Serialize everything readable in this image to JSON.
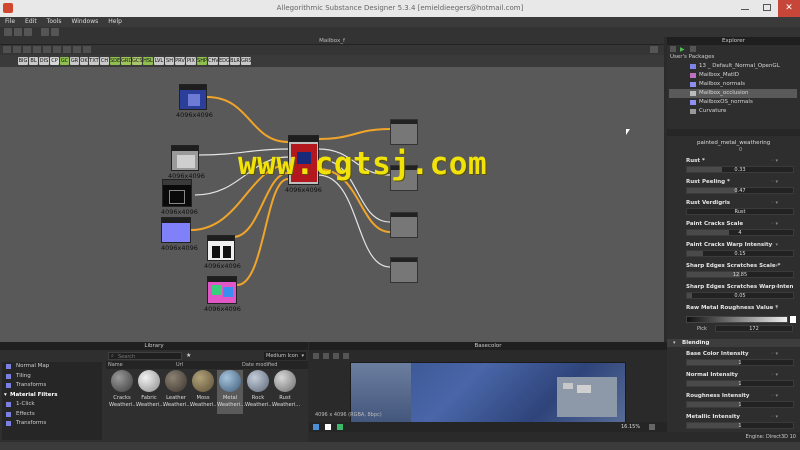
{
  "window": {
    "title": "Allegorithmic Substance Designer 5.3.4 [emieldieegers@hotmail.com]"
  },
  "menu": [
    "File",
    "Edit",
    "Tools",
    "Windows",
    "Help"
  ],
  "graph": {
    "tab_title": "Mailbox_f",
    "chips": [
      "BIG",
      "BL",
      "DIS",
      "CP",
      "GC",
      "GR",
      "OK",
      "TXT",
      "CH",
      "SDE",
      "GRD",
      "GCS",
      "HSL",
      "LVL",
      "SH",
      "PRV",
      "PIX",
      "SHP",
      "CHV",
      "EDG",
      "BLR",
      "GRS"
    ],
    "node_res": "4096x4096",
    "watermark": "www.cgtsj.com"
  },
  "library": {
    "title": "Library",
    "search_placeholder": "Search",
    "size_option": "Medium Icon",
    "columns": [
      "Name",
      "Url",
      "Date modified"
    ],
    "tree": [
      {
        "label": "Normal Map",
        "type": "item"
      },
      {
        "label": "Tiling",
        "type": "item"
      },
      {
        "label": "Transforms",
        "type": "item"
      },
      {
        "label": "Material Filters",
        "type": "category"
      },
      {
        "label": "1-Click",
        "type": "item"
      },
      {
        "label": "Effects",
        "type": "item"
      },
      {
        "label": "Transforms",
        "type": "item"
      }
    ],
    "materials": [
      {
        "line1": "Cracks",
        "line2": "Weatheri..."
      },
      {
        "line1": "Fabric",
        "line2": "Weatheri..."
      },
      {
        "line1": "Leather",
        "line2": "Weatheri..."
      },
      {
        "line1": "Moss",
        "line2": "Weatheri..."
      },
      {
        "line1": "Metal",
        "line2": "Weatheri..."
      },
      {
        "line1": "Rock",
        "line2": "Weatheri..."
      },
      {
        "line1": "Rust",
        "line2": "Weatheri..."
      }
    ]
  },
  "baseview": {
    "title": "Basecolor",
    "info": "4096 x 4096 (RGBA, 8bpc)",
    "zoom": "16.15%"
  },
  "explorer": {
    "title": "Explorer",
    "section": "User's Packages",
    "packages": [
      {
        "label": "13 _ Default_Normal_OpenGL",
        "color": "#7e84e6"
      },
      {
        "label": "Mailbox_MatID",
        "color": "#c070c0"
      },
      {
        "label": "Mailbox_normals",
        "color": "#8e8ef0"
      },
      {
        "label": "Mailbox_occlusion",
        "color": "#bbbbbb"
      },
      {
        "label": "MailboxOS_normals",
        "color": "#9090f0"
      },
      {
        "label": "Curvature",
        "color": "#999999"
      }
    ]
  },
  "params": {
    "node_title": "painted_metal_weathering",
    "top_value": "0",
    "items": [
      {
        "label": "Rust *",
        "value": "0.33",
        "fill": 0.33
      },
      {
        "label": "Rust Peeling *",
        "value": "0.47",
        "fill": 0.47
      },
      {
        "label": "Rust Verdigris",
        "value": "Rust",
        "fill": 0
      },
      {
        "label": "Paint Cracks Scale",
        "value": "4",
        "fill": 0.4
      },
      {
        "label": "Paint Cracks Warp Intensity",
        "value": "0.15",
        "fill": 0.15
      },
      {
        "label": "Sharp Edges Scratches Scale *",
        "value": "12.85",
        "fill": 0.5
      },
      {
        "label": "Sharp Edges Scratches Warp Inten",
        "value": "0.05",
        "fill": 0.05
      },
      {
        "label": "Raw Metal Roughness Value *",
        "value": "",
        "fill": 0
      }
    ],
    "picker_mode": "Pick",
    "picker_value": "172",
    "section2": "Blending",
    "items2": [
      {
        "label": "Base Color Intensity",
        "value": "1",
        "fill": 0.5
      },
      {
        "label": "Normal Intensity",
        "value": "1",
        "fill": 0.5
      },
      {
        "label": "Roughness Intensity",
        "value": "1",
        "fill": 0.5
      },
      {
        "label": "Metallic Intensity",
        "value": "1",
        "fill": 0.5
      }
    ]
  },
  "status": {
    "engine": "Engine: Direct3D 10"
  }
}
